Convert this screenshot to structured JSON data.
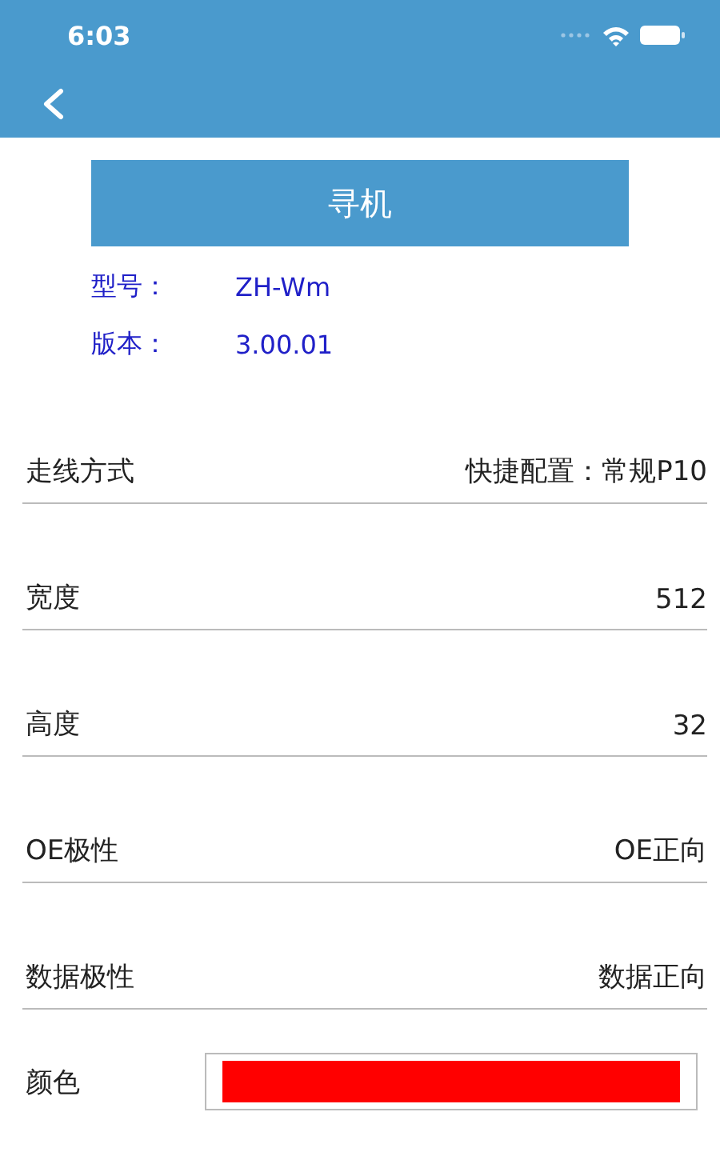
{
  "status_bar": {
    "time": "6:03"
  },
  "action_button": "寻机",
  "info": [
    {
      "label": "型号：",
      "value": "ZH-Wm"
    },
    {
      "label": "版本：",
      "value": "3.00.01"
    }
  ],
  "settings": [
    {
      "kind": "text",
      "label": "走线方式",
      "value": "快捷配置：常规P10"
    },
    {
      "kind": "text",
      "label": "宽度",
      "value": "512"
    },
    {
      "kind": "text",
      "label": "高度",
      "value": "32"
    },
    {
      "kind": "text",
      "label": "OE极性",
      "value": "OE正向"
    },
    {
      "kind": "text",
      "label": "数据极性",
      "value": "数据正向"
    },
    {
      "kind": "color",
      "label": "颜色",
      "color": "#ff0000"
    }
  ]
}
